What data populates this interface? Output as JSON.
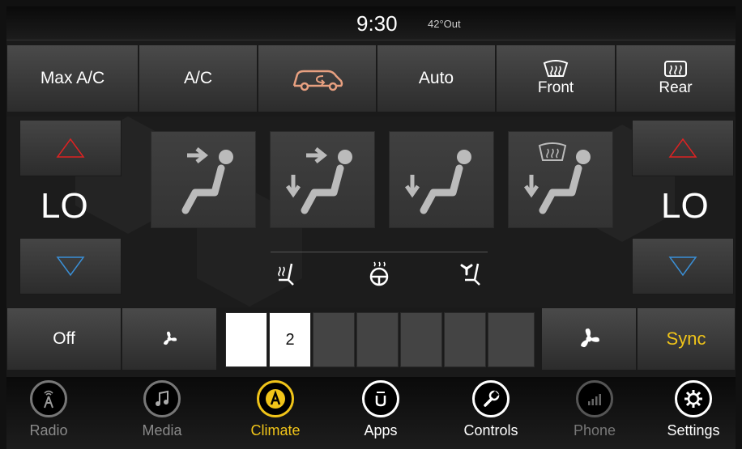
{
  "status_bar": {
    "time": "9:30",
    "outside_temp": "42°Out"
  },
  "top_buttons": {
    "max_ac": "Max A/C",
    "ac": "A/C",
    "recirculation_icon": "car-recirculation-icon",
    "auto": "Auto",
    "front_defrost": "Front",
    "rear_defrost": "Rear"
  },
  "driver_temp": {
    "value": "LO"
  },
  "passenger_temp": {
    "value": "LO"
  },
  "fan": {
    "off_label": "Off",
    "level": "2",
    "level_fraction": 0.2,
    "sync_label": "Sync"
  },
  "colors": {
    "accent_yellow": "#f0c419",
    "up_arrow": "#d22",
    "down_arrow": "#3a8fd6",
    "dim_text": "#8a8a8a"
  },
  "nav": {
    "radio": "Radio",
    "media": "Media",
    "climate": "Climate",
    "apps": "Apps",
    "controls": "Controls",
    "phone": "Phone",
    "settings": "Settings"
  }
}
